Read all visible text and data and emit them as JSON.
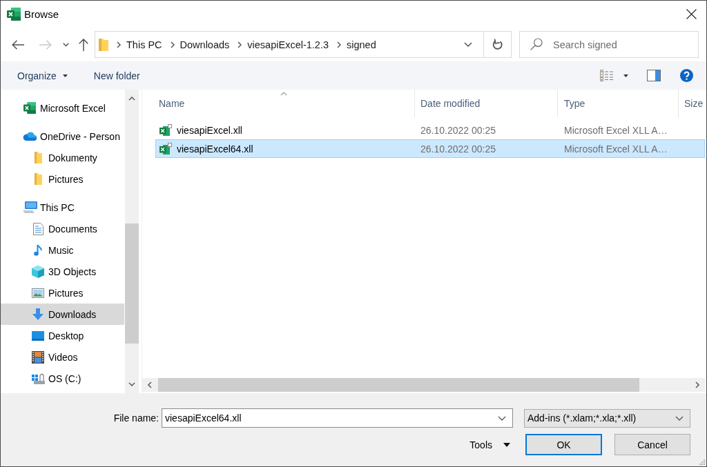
{
  "window": {
    "title": "Browse"
  },
  "navigation_buttons": [
    {
      "kind": "back",
      "disabled": false
    },
    {
      "kind": "forward",
      "disabled": true
    },
    {
      "kind": "recent",
      "disabled": false
    },
    {
      "kind": "up",
      "disabled": false
    }
  ],
  "address_bar": {
    "segments": [
      "This PC",
      "Downloads",
      "viesapiExcel-1.2.3",
      "signed"
    ]
  },
  "search": {
    "placeholder": "Search signed"
  },
  "toolbar": {
    "items": [
      {
        "label": "Organize",
        "has_menu": true
      },
      {
        "label": "New folder",
        "has_menu": false
      }
    ]
  },
  "navigation_pane": {
    "items": [
      {
        "kind": "spreadsheet",
        "label": "Microsoft Excel",
        "selected": false
      },
      {
        "kind": "cloud",
        "label": "OneDrive - Person",
        "selected": false,
        "children": [
          {
            "kind": "folder",
            "label": "Dokumenty",
            "selected": false
          },
          {
            "kind": "folder",
            "label": "Pictures",
            "selected": false
          }
        ]
      },
      {
        "kind": "computer",
        "label": "This PC",
        "selected": false,
        "children": [
          {
            "kind": "documents",
            "label": "Documents",
            "selected": false
          },
          {
            "kind": "music",
            "label": "Music",
            "selected": false
          },
          {
            "kind": "objects",
            "label": "3D Objects",
            "selected": false
          },
          {
            "kind": "pictures",
            "label": "Pictures",
            "selected": false
          },
          {
            "kind": "downloads",
            "label": "Downloads",
            "selected": true
          },
          {
            "kind": "desktop",
            "label": "Desktop",
            "selected": false
          },
          {
            "kind": "videos",
            "label": "Videos",
            "selected": false
          },
          {
            "kind": "drive",
            "label": "OS (C:)",
            "selected": false
          }
        ]
      }
    ]
  },
  "file_list": {
    "columns": [
      {
        "label": "Name",
        "sorted": true
      },
      {
        "label": "Date modified",
        "sorted": false
      },
      {
        "label": "Type",
        "sorted": false
      },
      {
        "label": "Size",
        "sorted": false
      }
    ],
    "rows": [
      {
        "name": "viesapiExcel.xll",
        "date_modified": "26.10.2022 00:25",
        "type": "Microsoft Excel XLL A…",
        "selected": false
      },
      {
        "name": "viesapiExcel64.xll",
        "date_modified": "26.10.2022 00:25",
        "type": "Microsoft Excel XLL A…",
        "selected": true
      }
    ]
  },
  "file_name": {
    "label": "File name:",
    "value": "viesapiExcel64.xll"
  },
  "file_type": {
    "value": "Add-ins (*.xlam;*.xla;*.xll)"
  },
  "tools": {
    "label": "Tools"
  },
  "buttons": [
    {
      "label": "OK",
      "default": true
    },
    {
      "label": "Cancel",
      "default": false
    }
  ]
}
